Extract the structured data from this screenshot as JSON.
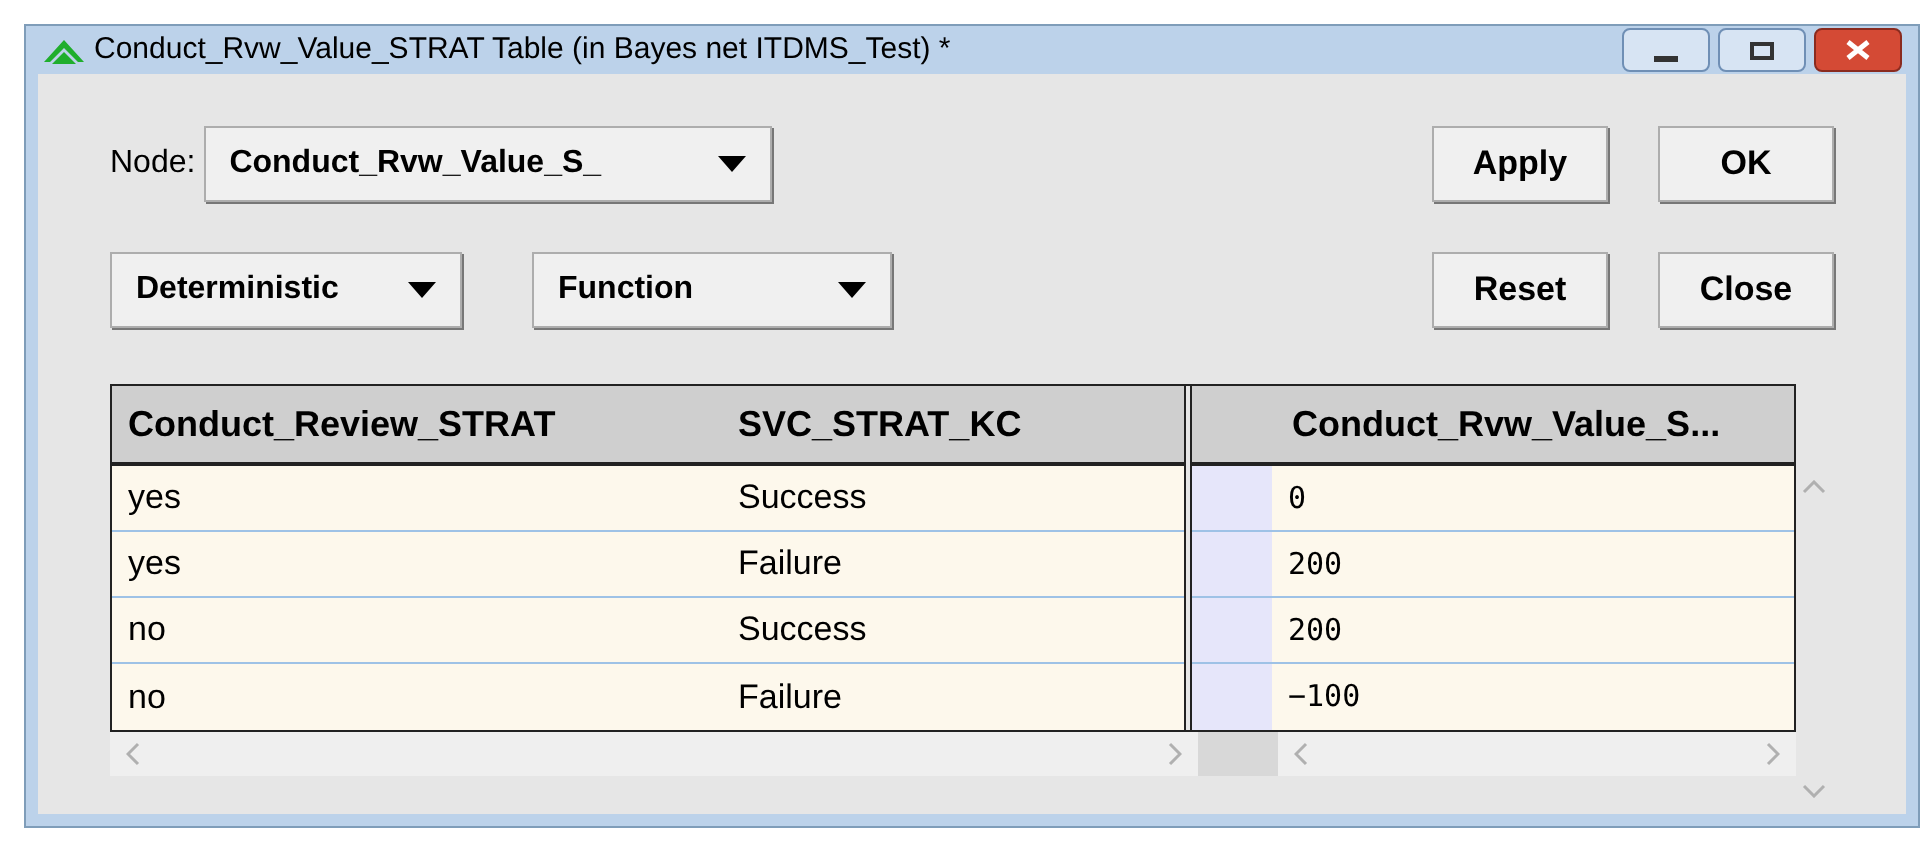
{
  "window": {
    "title": "Conduct_Rvw_Value_STRAT Table (in Bayes net ITDMS_Test) *"
  },
  "node": {
    "label": "Node:",
    "value": "Conduct_Rvw_Value_S_"
  },
  "selectors": [
    {
      "value": "Deterministic"
    },
    {
      "value": "Function"
    }
  ],
  "buttons": [
    "Apply",
    "OK",
    "Reset",
    "Close"
  ],
  "table": {
    "columns": [
      "Conduct_Review_STRAT",
      "SVC_STRAT_KC"
    ],
    "value_column": "Conduct_Rvw_Value_S...",
    "rows": [
      {
        "cells": [
          "yes",
          "Success"
        ],
        "value": "0"
      },
      {
        "cells": [
          "yes",
          "Failure"
        ],
        "value": "200"
      },
      {
        "cells": [
          "no",
          "Success"
        ],
        "value": "200"
      },
      {
        "cells": [
          "no",
          "Failure"
        ],
        "value": "−100"
      }
    ]
  }
}
